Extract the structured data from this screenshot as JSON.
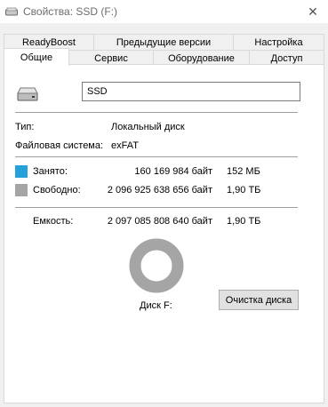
{
  "window": {
    "title": "Свойства: SSD (F:)"
  },
  "tabs_row1": [
    {
      "label": "ReadyBoost"
    },
    {
      "label": "Предыдущие версии"
    },
    {
      "label": "Настройка"
    }
  ],
  "tabs_row2": [
    {
      "label": "Общие"
    },
    {
      "label": "Сервис"
    },
    {
      "label": "Оборудование"
    },
    {
      "label": "Доступ"
    }
  ],
  "general": {
    "name_value": "SSD",
    "type_label": "Тип:",
    "type_value": "Локальный диск",
    "fs_label": "Файловая система:",
    "fs_value": "exFAT",
    "used_label": "Занято:",
    "used_bytes": "160 169 984 байт",
    "used_short": "152 МБ",
    "free_label": "Свободно:",
    "free_bytes": "2 096 925 638 656 байт",
    "free_short": "1,90 ТБ",
    "capacity_label": "Емкость:",
    "capacity_bytes": "2 097 085 808 640 байт",
    "capacity_short": "1,90 ТБ",
    "disk_label": "Диск F:",
    "cleanup_button": "Очистка диска",
    "used_fraction": 7.64e-05,
    "used_color": "#26a0da",
    "free_color": "#a5a5a5"
  }
}
